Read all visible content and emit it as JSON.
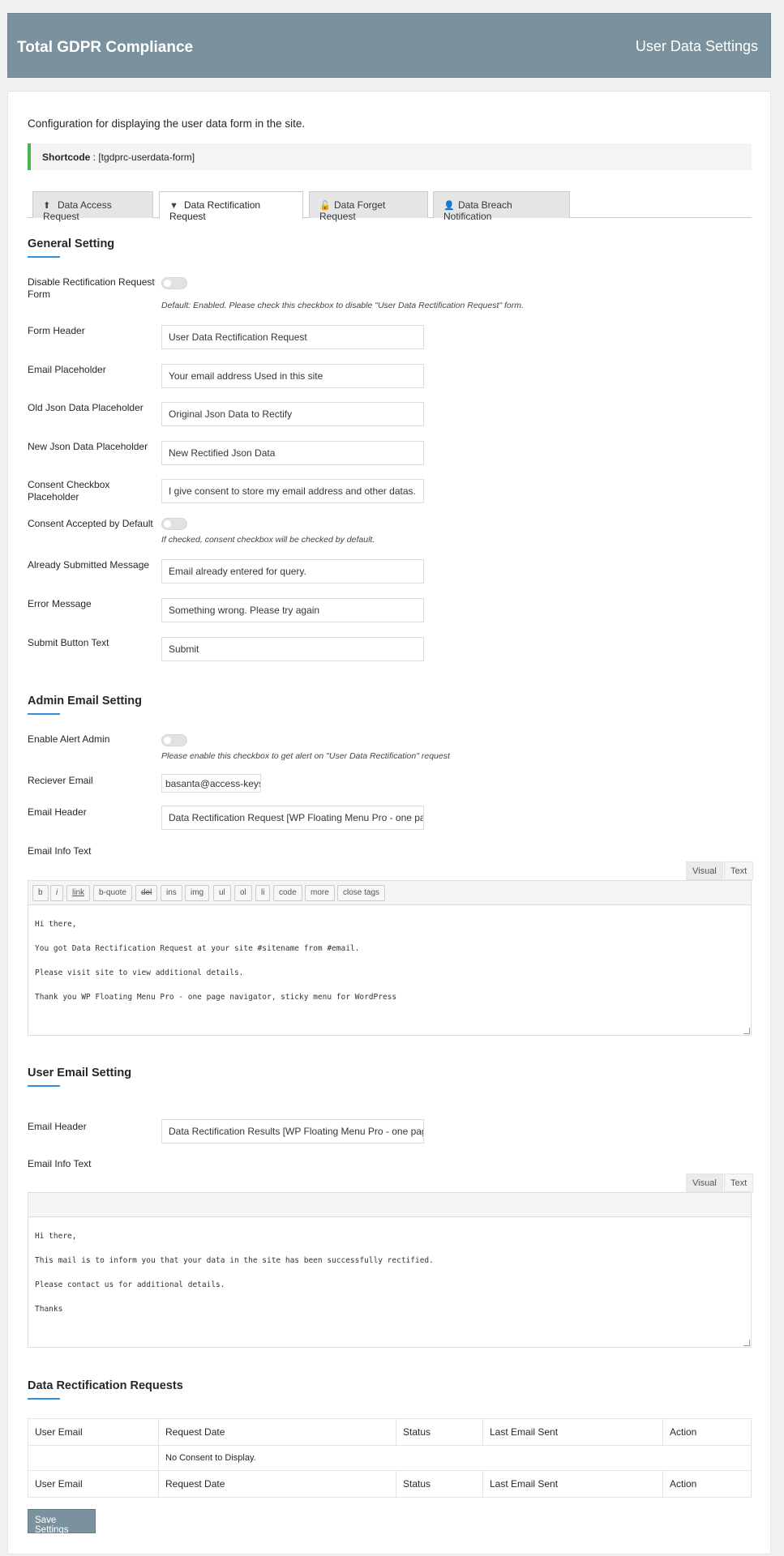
{
  "header": {
    "title": "Total GDPR Compliance",
    "subtitle": "User Data Settings"
  },
  "intro": "Configuration for displaying the user data form in the site.",
  "shortcode": {
    "label": "Shortcode",
    "value": " : [tgdprc-userdata-form]"
  },
  "tabs": [
    {
      "label": "Data Access Request",
      "icon": "upload-icon",
      "glyph": "⬆",
      "active": false
    },
    {
      "label": "Data Rectification Request",
      "icon": "filter-icon",
      "glyph": "▼",
      "active": true
    },
    {
      "label": "Data Forget Request",
      "icon": "unlock-icon",
      "glyph": "🔓",
      "active": false
    },
    {
      "label": "Data Breach Notification",
      "icon": "user-secret-icon",
      "glyph": "👤",
      "active": false
    }
  ],
  "general": {
    "title": "General Setting",
    "disable_label": "Disable Rectification Request Form",
    "disable_hint": "Default: Enabled. Please check this checkbox to disable \"User Data Rectification Request\" form.",
    "form_header_label": "Form Header",
    "form_header_value": "User Data Rectification Request",
    "email_placeholder_label": "Email Placeholder",
    "email_placeholder_value": "Your email address Used in this site",
    "old_json_label": "Old Json Data Placeholder",
    "old_json_value": "Original Json Data to Rectify",
    "new_json_label": "New Json Data Placeholder",
    "new_json_value": "New Rectified Json Data",
    "consent_placeholder_label": "Consent Checkbox Placeholder",
    "consent_placeholder_value": "I give consent to store my email address and other datas.",
    "consent_default_label": "Consent Accepted by Default",
    "consent_default_hint": "If checked, consent checkbox will be checked by default.",
    "already_submitted_label": "Already Submitted Message",
    "already_submitted_value": "Email already entered for query.",
    "error_label": "Error Message",
    "error_value": "Something wrong. Please try again",
    "submit_label": "Submit Button Text",
    "submit_value": "Submit"
  },
  "admin": {
    "title": "Admin Email Setting",
    "enable_label": "Enable Alert Admin",
    "enable_hint": "Please enable this checkbox to get alert on \"User Data Rectification\" request",
    "receiver_label": "Reciever Email",
    "receiver_value": "basanta@access-keys.c",
    "header_label": "Email Header",
    "header_value": "Data Rectification Request [WP Floating Menu Pro - one page",
    "info_label": "Email Info Text",
    "visual_tab": "Visual",
    "text_tab": "Text",
    "buttons": [
      "b",
      "i",
      "link",
      "b-quote",
      "del",
      "ins",
      "img",
      "ul",
      "ol",
      "li",
      "code",
      "more",
      "close tags"
    ],
    "lines": [
      "Hi there,",
      "You got Data Rectification Request at your site #sitename from #email.",
      "Please visit site to view additional details.",
      "Thank you WP Floating Menu Pro - one page navigator, sticky menu for WordPress"
    ]
  },
  "user": {
    "title": "User Email Setting",
    "header_label": "Email Header",
    "header_value": "Data Rectification Results [WP Floating Menu Pro - one page",
    "info_label": "Email Info Text",
    "visual_tab": "Visual",
    "text_tab": "Text",
    "lines": [
      "Hi there,",
      "This mail is to inform you that your data in the site has been successfully rectified.",
      "Please contact us for additional details.",
      "Thanks"
    ]
  },
  "requests": {
    "title": "Data Rectification Requests",
    "columns": [
      "User Email",
      "Request Date",
      "Status",
      "Last Email Sent",
      "Action"
    ],
    "empty": "No Consent to Display."
  },
  "save_label": "Save Settings"
}
